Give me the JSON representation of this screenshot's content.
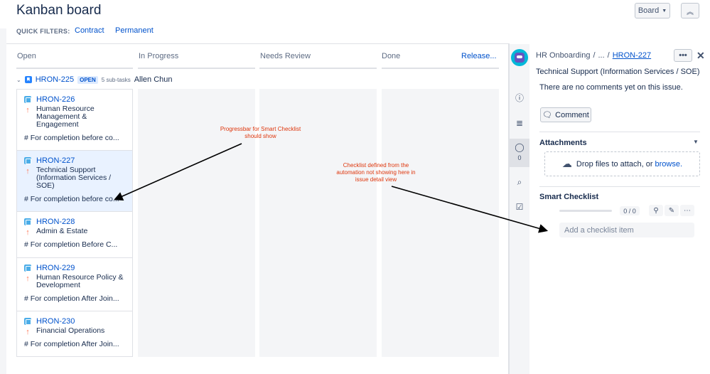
{
  "header": {
    "title": "Kanban board",
    "board_button": "Board",
    "collapse_icon": "double-chevron-up-icon"
  },
  "quick_filters": {
    "label": "QUICK FILTERS:",
    "items": [
      "Contract",
      "Permanent"
    ]
  },
  "columns": [
    "Open",
    "In Progress",
    "Needs Review",
    "Done"
  ],
  "release_link": "Release...",
  "swimlane": {
    "key": "HRON-225",
    "status": "OPEN",
    "subtasks": "5 sub-tasks",
    "assignee": "Allen Chun"
  },
  "cards": [
    {
      "key": "HRON-226",
      "summary": "Human Resource Management & Engagement",
      "description": "# For completion before co..."
    },
    {
      "key": "HRON-227",
      "summary": "Technical Support (Information Services / SOE)",
      "description": "# For completion before co..."
    },
    {
      "key": "HRON-228",
      "summary": "Admin & Estate",
      "description": "# For completion Before C..."
    },
    {
      "key": "HRON-229",
      "summary": "Human Resource Policy & Development",
      "description": "# For completion After Join..."
    },
    {
      "key": "HRON-230",
      "summary": "Financial Operations",
      "description": "# For completion After Join..."
    }
  ],
  "detail": {
    "breadcrumb_project": "HR Onboarding",
    "breadcrumb_sep": "/",
    "breadcrumb_parent": "...",
    "breadcrumb_key": "HRON-227",
    "title": "Technical Support (Information Services / SOE)",
    "no_comments": "There are no comments yet on this issue.",
    "comment_button": "Comment",
    "comment_count": "0",
    "attachments_title": "Attachments",
    "dropzone_text": "Drop files to attach, or",
    "dropzone_browse": "browse.",
    "smart_checklist_title": "Smart Checklist",
    "checklist_progress": 0,
    "checklist_count": "0 / 0",
    "checklist_placeholder": "Add a checklist item"
  },
  "annotations": {
    "progressbar_note": "Progressbar for Smart Checklist should show",
    "checklist_note": "Checklist defined from the automation not showing here in issue detail view",
    "color": "#de350b"
  },
  "colors": {
    "link": "#0052cc",
    "priority_arrow": "#ff7452",
    "story_icon": "#2684ff",
    "subtask_icon": "#4bade8",
    "column_bg": "#f4f5f7"
  }
}
